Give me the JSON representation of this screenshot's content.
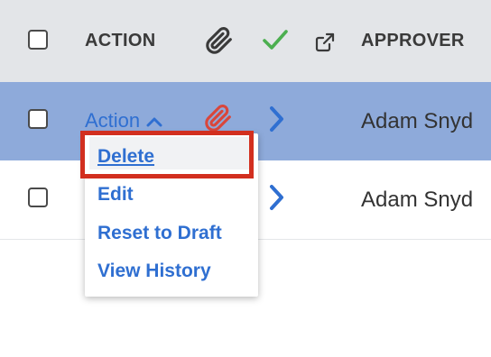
{
  "header": {
    "action_label": "ACTION",
    "approver_label": "APPROVER",
    "icons": [
      "select-all-checkbox",
      "paperclip-icon",
      "checkmark-icon",
      "external-link-icon"
    ]
  },
  "rows": [
    {
      "selected": true,
      "action_label": "Action",
      "action_icon": "chevron-up-icon",
      "attachment_icon": "paperclip-icon",
      "attachment_color": "#d9463b",
      "navigate_icon": "chevron-right-icon",
      "approver": "Adam Snyd"
    },
    {
      "selected": false,
      "navigate_icon": "chevron-right-icon",
      "approver": "Adam Snyd"
    }
  ],
  "action_menu": {
    "items": [
      "Delete",
      "Edit",
      "Reset to Draft",
      "View History"
    ],
    "hovered_item": "Delete"
  },
  "colors": {
    "header_bg": "#e3e5e8",
    "selected_row_bg": "#8eaada",
    "link": "#2f6fd1",
    "check_green": "#4caf50",
    "highlight_red": "#d22f1f"
  }
}
